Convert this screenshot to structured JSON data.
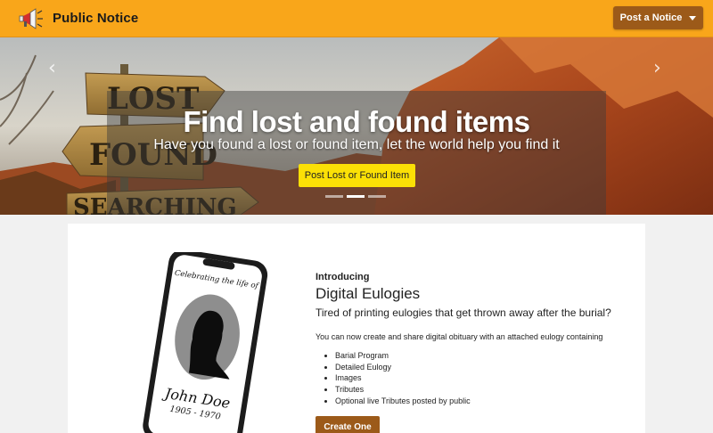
{
  "navbar": {
    "brand_icon": "megaphone-icon",
    "brand_name": "Public Notice",
    "post_button": "Post a Notice"
  },
  "hero": {
    "title": "Find lost and found items",
    "subtitle": "Have you found a lost or found item, let the world help you find it",
    "cta": "Post Lost or Found Item",
    "prev_icon": "chevron-left-icon",
    "next_icon": "chevron-right-icon",
    "slides": 3,
    "active_slide": 2,
    "sign_words": [
      "LOST",
      "FOUND",
      "SEARCHING"
    ]
  },
  "promo": {
    "phone_caption": "Celebrating the life of",
    "phone_name": "John Doe",
    "phone_years": "1905 - 1970",
    "kicker": "Introducing",
    "title": "Digital Eulogies",
    "lead": "Tired of printing eulogies that get thrown away after the burial?",
    "text": "You can now create and share digital obituary with an attached eulogy containing",
    "features": [
      "Barial Program",
      "Detailed Eulogy",
      "Images",
      "Tributes",
      "Optional live Tributes posted by public"
    ],
    "cta": "Create One"
  },
  "colors": {
    "navbar": "#f9a61a",
    "brown_button": "#9c5a19",
    "yellow_button": "#fbe006"
  }
}
